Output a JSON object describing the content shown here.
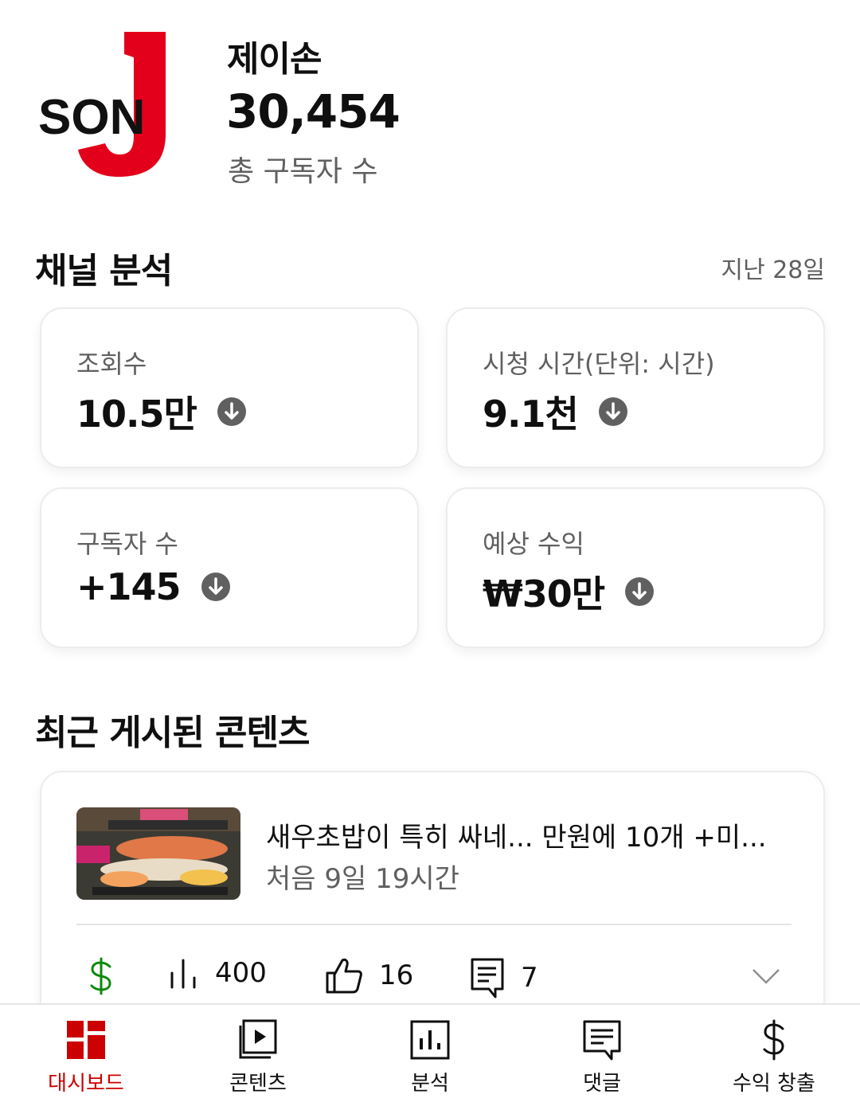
{
  "channel": {
    "name": "제이손",
    "subscriber_count": "30,454",
    "subscriber_label": "총 구독자 수",
    "logo_text": "SON J"
  },
  "analytics": {
    "title": "채널 분석",
    "period": "지난 28일",
    "metrics": [
      {
        "label": "조회수",
        "value": "10.5만",
        "trend": "down"
      },
      {
        "label": "시청 시간(단위: 시간)",
        "value": "9.1천",
        "trend": "down"
      },
      {
        "label": "구독자 수",
        "value": "+145",
        "trend": "down"
      },
      {
        "label": "예상 수익",
        "value": "₩30만",
        "trend": "down"
      }
    ]
  },
  "recent": {
    "title": "최근 게시된 콘텐츠",
    "video": {
      "title": "새우초밥이 특히 싸네... 만원에 10개 +미...",
      "age": "처음 9일 19시간",
      "views": "400",
      "likes": "16",
      "comments": "7"
    }
  },
  "nav": {
    "items": [
      {
        "label": "대시보드",
        "active": true
      },
      {
        "label": "콘텐츠",
        "active": false
      },
      {
        "label": "분석",
        "active": false
      },
      {
        "label": "댓글",
        "active": false
      },
      {
        "label": "수익 창출",
        "active": false
      }
    ]
  },
  "colors": {
    "accent": "#cc0000",
    "monetize_green": "#0a8a0a",
    "trend_icon": "#606060"
  }
}
